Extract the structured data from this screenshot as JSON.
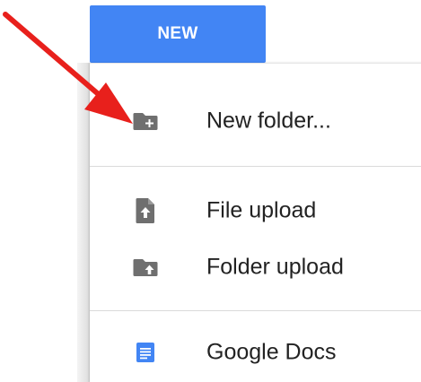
{
  "new_button": {
    "label": "NEW",
    "color": "#4285f4"
  },
  "menu": {
    "items": [
      {
        "label": "New folder...",
        "icon": "new-folder-icon"
      },
      {
        "label": "File upload",
        "icon": "file-upload-icon"
      },
      {
        "label": "Folder upload",
        "icon": "folder-upload-icon"
      },
      {
        "label": "Google Docs",
        "icon": "google-docs-icon",
        "color": "#4285f4"
      }
    ]
  },
  "annotation": {
    "arrow_color": "#e8201c",
    "icon": "red-arrow-icon"
  }
}
